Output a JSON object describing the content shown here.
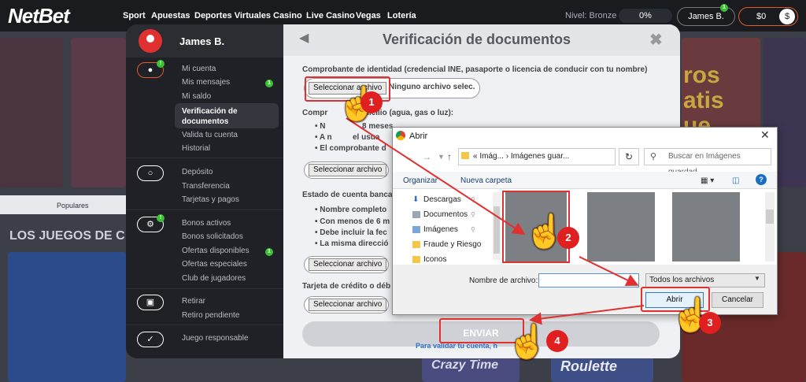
{
  "header": {
    "logo": "NetBet",
    "nav": [
      "Sport",
      "Apuestas",
      "Deportes Virtuales",
      "Casino",
      "Live Casino",
      "Vegas",
      "Lotería"
    ],
    "level_label": "Nivel: Bronze",
    "level_progress": "0%",
    "username": "James B.",
    "user_badge": "1",
    "balance": "$0"
  },
  "background": {
    "popular_label": "Populares",
    "section_heading": "LOS JUEGOS DE C",
    "promo_text": "ros\natis\nue",
    "tile_crazy": "Crazy Time",
    "tile_roulette": "Roulette"
  },
  "sidebar": {
    "username": "James B.",
    "groups": [
      {
        "icon": "user-icon",
        "badge": "!",
        "items": [
          "Mi cuenta",
          "Mis mensajes",
          "Mi saldo",
          "Verificación de documentos",
          "Valida tu cuenta",
          "Historial"
        ],
        "active": "Verificación de documentos",
        "item_badges": {
          "Mis mensajes": "1"
        }
      },
      {
        "icon": "coins-icon",
        "items": [
          "Depósito",
          "Transferencia",
          "Tarjetas y pagos"
        ]
      },
      {
        "icon": "gear-icon",
        "badge": "!",
        "items": [
          "Bonos activos",
          "Bonos solicitados",
          "Ofertas disponibles",
          "Ofertas especiales",
          "Club de jugadores"
        ],
        "item_badges": {
          "Ofertas disponibles": "1"
        }
      },
      {
        "icon": "withdraw-icon",
        "items": [
          "Retirar",
          "Retiro pendiente"
        ]
      },
      {
        "icon": "shield-icon",
        "items": [
          "Juego responsable"
        ]
      }
    ]
  },
  "modal": {
    "title": "Verificación de documentos",
    "sections": [
      {
        "label": "Comprobante de identidad (credencial INE, pasaporte o licencia de conducir con tu nombre)",
        "button": "Seleccionar archivo",
        "status": "Ninguno archivo selec."
      },
      {
        "label": "Compr",
        "label_tail": "micilio (agua, gas o luz):",
        "bullets": [
          "N",
          "A n",
          "El comprobante d"
        ],
        "bullet_tails": [
          "8 meses",
          "el usua",
          ""
        ],
        "button": "Seleccionar archivo"
      },
      {
        "label": "Estado de cuenta banca",
        "bullets": [
          "Nombre completo",
          "Con menos de 6 m",
          "Debe incluir la fec",
          "La misma direcció"
        ],
        "button": "Seleccionar archivo"
      },
      {
        "label": "Tarjeta de crédito o déb",
        "button": "Seleccionar archivo"
      }
    ],
    "submit": "ENVIAR",
    "validate_link": "Para validar tu cuenta, h"
  },
  "dialog": {
    "title": "Abrir",
    "path": [
      "Imág...",
      "Imágenes guar..."
    ],
    "search_placeholder": "Buscar en Imágenes guardad...",
    "organize": "Organizar",
    "new_folder": "Nueva carpeta",
    "tree": [
      "Descargas",
      "Documentos",
      "Imágenes",
      "Fraude y Riesgo",
      "Iconos"
    ],
    "filename_label": "Nombre de archivo:",
    "filename_value": "",
    "filetype": "Todos los archivos",
    "open": "Abrir",
    "cancel": "Cancelar"
  },
  "steps": [
    "1",
    "2",
    "3",
    "4"
  ],
  "colors": {
    "brand_red": "#e03030",
    "success_green": "#39c232",
    "link_blue": "#2f6fca"
  }
}
